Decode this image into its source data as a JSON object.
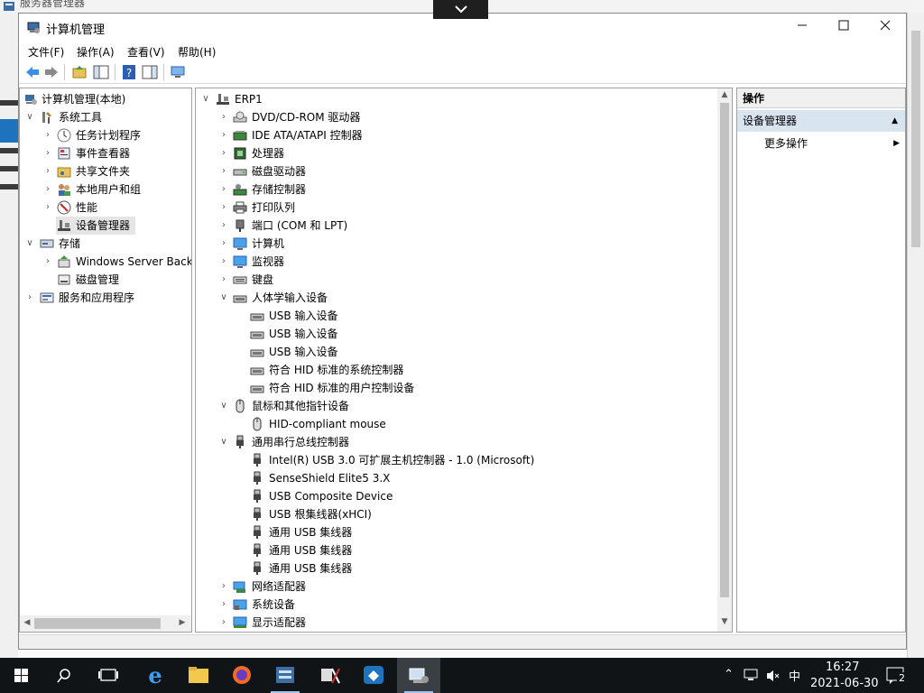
{
  "background_window": {
    "title": "服务器管理器"
  },
  "window": {
    "title": "计算机管理",
    "menu": [
      "文件(F)",
      "操作(A)",
      "查看(V)",
      "帮助(H)"
    ]
  },
  "tree": {
    "root": "计算机管理(本地)",
    "system_tools": "系统工具",
    "task_scheduler": "任务计划程序",
    "event_viewer": "事件查看器",
    "shared_folders": "共享文件夹",
    "local_users": "本地用户和组",
    "performance": "性能",
    "device_manager": "设备管理器",
    "storage": "存储",
    "windows_backup": "Windows Server Back",
    "disk_management": "磁盘管理",
    "services_apps": "服务和应用程序"
  },
  "devices": {
    "computer": "ERP1",
    "categories": {
      "dvd": "DVD/CD-ROM 驱动器",
      "ide": "IDE ATA/ATAPI 控制器",
      "cpu": "处理器",
      "disk": "磁盘驱动器",
      "storage": "存储控制器",
      "print": "打印队列",
      "ports": "端口 (COM 和 LPT)",
      "computer": "计算机",
      "monitor": "监视器",
      "keyboard": "键盘",
      "hid": "人体学输入设备",
      "mouse": "鼠标和其他指针设备",
      "usb": "通用串行总线控制器",
      "network": "网络适配器",
      "system": "系统设备",
      "display": "显示适配器"
    },
    "hid_items": [
      "USB 输入设备",
      "USB 输入设备",
      "USB 输入设备",
      "符合 HID 标准的系统控制器",
      "符合 HID 标准的用户控制设备"
    ],
    "mouse_items": [
      "HID-compliant mouse"
    ],
    "usb_items": [
      "Intel(R) USB 3.0 可扩展主机控制器 - 1.0 (Microsoft)",
      "SenseShield Elite5 3.X",
      "USB Composite Device",
      "USB 根集线器(xHCI)",
      "通用 USB 集线器",
      "通用 USB 集线器",
      "通用 USB 集线器"
    ]
  },
  "actions": {
    "header": "操作",
    "section": "设备管理器",
    "more": "更多操作"
  },
  "taskbar": {
    "ime": "中",
    "time": "16:27",
    "date": "2021-06-30",
    "notifications": "2"
  },
  "colors": {
    "taskbar": "#111417",
    "action_section": "#d9e4f1",
    "selection": "#e5e5e5",
    "accent_blue": "#1e73be"
  }
}
